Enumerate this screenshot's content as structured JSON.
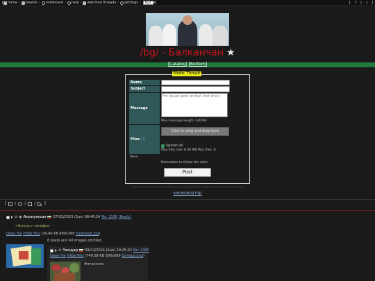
{
  "topnav": {
    "home": "home",
    "boards": "boards",
    "overboard": "overboard",
    "help": "help",
    "watched": "watched threads",
    "settings": "settings",
    "theme_value": "Nuit",
    "sep": "/"
  },
  "board": {
    "title": "/bg/ - Балканчан",
    "star": "★"
  },
  "nav": {
    "catalog": "[Catalog]",
    "bottom": "[Bottom]"
  },
  "form": {
    "mode": "Mode: Thread",
    "name_label": "Name",
    "subject_label": "Subject",
    "message_label": "Message",
    "message_placeholder": "For issues post on test (not lynx)",
    "max_length": "Max message length: 0/4096",
    "files_label": "Files",
    "files_help": "(?)",
    "dropzone": "Click or drag and drop here",
    "spoiler": "Spoiler all",
    "max_files": "Max files size: 6.00 MB Max files: 8",
    "more": "More",
    "rules": "Remember to follow the rules",
    "post_button": "Post"
  },
  "ban_link": "кисмпизатор",
  "toolbar": {
    "open": "[",
    "close": "]"
  },
  "op": {
    "name": "Anonymous",
    "date": "07/02/2023 (Sun) 08:46:24",
    "no": "No. 1106",
    "reply": "[Reply]",
    "greentext": ">бумър с телефон",
    "open_file": "Open file",
    "hide_file": "(Hide file)",
    "file_info": "(34.40 KB 480x360 ",
    "file_name": "tvidefault.jpg",
    "file_close": ")",
    "omitted": "8 posts and 40 images omitted."
  },
  "reply": {
    "name": "Чичдар",
    "date": "09/22/2024 (Sun) 19:25:02",
    "no": "No. 1365",
    "open_file": "Open file",
    "hide_file": "(Hide file)",
    "file_info": "(749.08 KB 590x699 ",
    "file_name": "1ztwqui.png",
    "file_close": ")",
    "text": "#ятелсете"
  }
}
